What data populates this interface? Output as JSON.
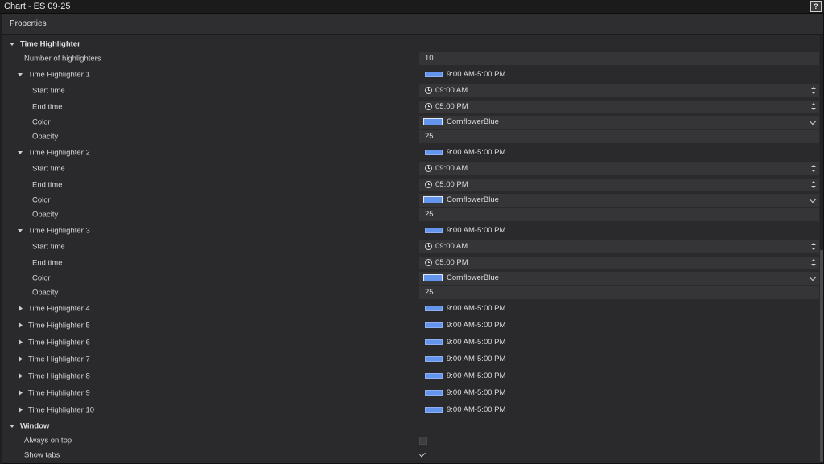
{
  "window": {
    "title": "Chart - ES 09-25",
    "help": "?"
  },
  "panel": {
    "header": "Properties"
  },
  "time_highlighter": {
    "section_label": "Time Highlighter",
    "count_label": "Number of highlighters",
    "count_value": "10",
    "highlighters": [
      {
        "label": "Time Highlighter 1",
        "summary": "9:00 AM-5:00 PM",
        "start_label": "Start time",
        "start": "09:00 AM",
        "end_label": "End time",
        "end": "05:00 PM",
        "color_label": "Color",
        "color": "CornflowerBlue",
        "opacity_label": "Opacity",
        "opacity": "25"
      },
      {
        "label": "Time Highlighter 2",
        "summary": "9:00 AM-5:00 PM",
        "start_label": "Start time",
        "start": "09:00 AM",
        "end_label": "End time",
        "end": "05:00 PM",
        "color_label": "Color",
        "color": "CornflowerBlue",
        "opacity_label": "Opacity",
        "opacity": "25"
      },
      {
        "label": "Time Highlighter 3",
        "summary": "9:00 AM-5:00 PM",
        "start_label": "Start time",
        "start": "09:00 AM",
        "end_label": "End time",
        "end": "05:00 PM",
        "color_label": "Color",
        "color": "CornflowerBlue",
        "opacity_label": "Opacity",
        "opacity": "25"
      },
      {
        "label": "Time Highlighter 4",
        "summary": "9:00 AM-5:00 PM"
      },
      {
        "label": "Time Highlighter 5",
        "summary": "9:00 AM-5:00 PM"
      },
      {
        "label": "Time Highlighter 6",
        "summary": "9:00 AM-5:00 PM"
      },
      {
        "label": "Time Highlighter 7",
        "summary": "9:00 AM-5:00 PM"
      },
      {
        "label": "Time Highlighter 8",
        "summary": "9:00 AM-5:00 PM"
      },
      {
        "label": "Time Highlighter 9",
        "summary": "9:00 AM-5:00 PM"
      },
      {
        "label": "Time Highlighter 10",
        "summary": "9:00 AM-5:00 PM"
      }
    ]
  },
  "window_section": {
    "section_label": "Window",
    "always_on_top_label": "Always on top",
    "always_on_top": false,
    "show_tabs_label": "Show tabs",
    "show_tabs": true
  },
  "colors": {
    "highlight_color": "#6495ED",
    "background": "#2A2A2D",
    "field": "#353538"
  }
}
